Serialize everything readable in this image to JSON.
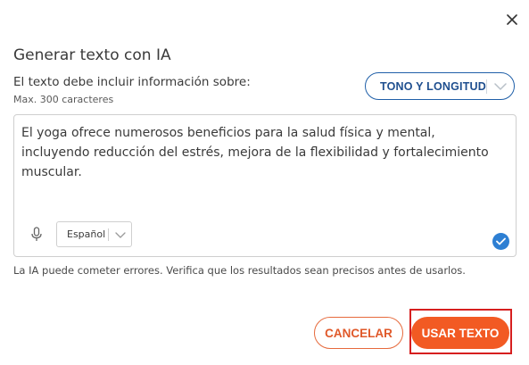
{
  "dialog": {
    "close_icon": "close-icon",
    "title": "Generar texto con IA",
    "label": "El texto debe incluir información sobre:",
    "sublabel": "Max. 300 caracteres"
  },
  "tone_select": {
    "label": "TONO Y LONGITUD",
    "icon": "chevron-down-icon"
  },
  "text_area": {
    "value": "El yoga ofrece numerosos beneficios para la salud física y mental, incluyendo reducción del estrés, mejora de la flexibilidad y fortalecimiento muscular.",
    "mic_icon": "microphone-icon",
    "check_icon": "check-icon"
  },
  "language_select": {
    "selected": "Español",
    "icon": "chevron-down-icon"
  },
  "disclaimer": "La IA puede cometer errores. Verifica que los resultados sean precisos antes de usarlos.",
  "actions": {
    "cancel_label": "CANCELAR",
    "use_label": "USAR TEXTO"
  },
  "colors": {
    "accent_orange": "#f25a23",
    "accent_blue": "#1f5fa8",
    "check_blue": "#2d7fd3",
    "highlight_red": "#d61f1f"
  }
}
